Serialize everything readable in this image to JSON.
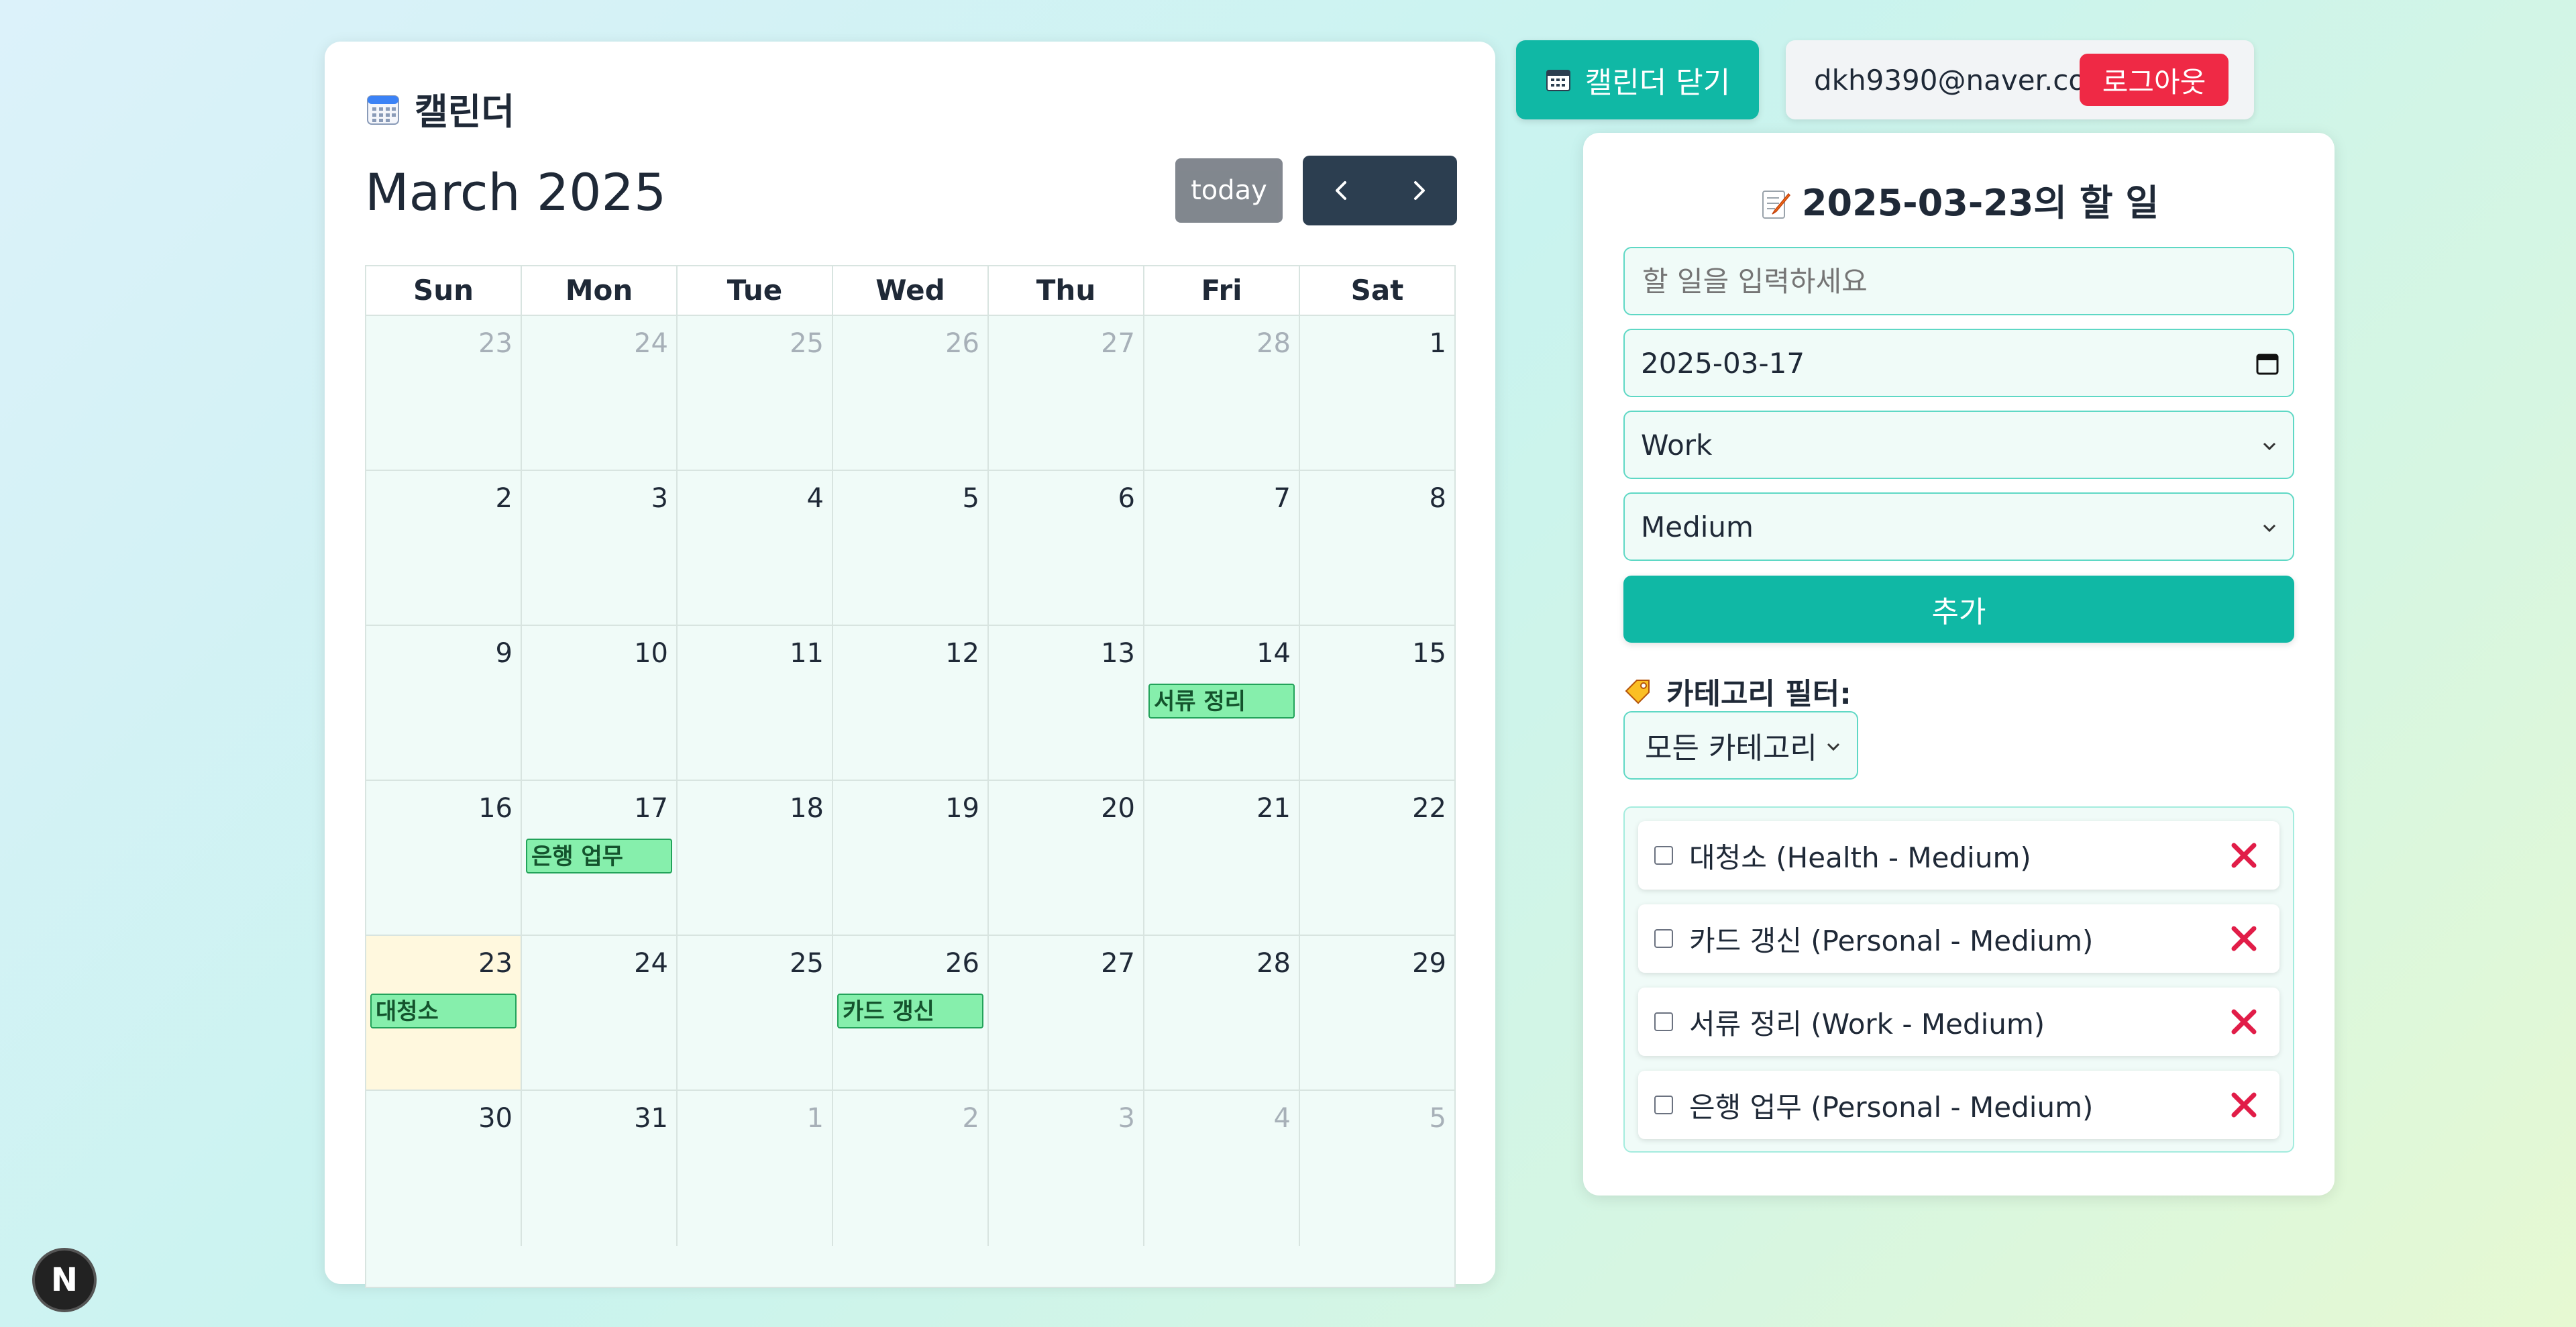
{
  "calendar": {
    "header_title": "캘린더",
    "month_title": "March 2025",
    "today_label": "today",
    "weekdays": [
      "Sun",
      "Mon",
      "Tue",
      "Wed",
      "Thu",
      "Fri",
      "Sat"
    ],
    "weeks": [
      [
        {
          "n": "23",
          "other": true
        },
        {
          "n": "24",
          "other": true
        },
        {
          "n": "25",
          "other": true
        },
        {
          "n": "26",
          "other": true
        },
        {
          "n": "27",
          "other": true
        },
        {
          "n": "28",
          "other": true
        },
        {
          "n": "1"
        }
      ],
      [
        {
          "n": "2"
        },
        {
          "n": "3"
        },
        {
          "n": "4"
        },
        {
          "n": "5"
        },
        {
          "n": "6"
        },
        {
          "n": "7"
        },
        {
          "n": "8"
        }
      ],
      [
        {
          "n": "9"
        },
        {
          "n": "10"
        },
        {
          "n": "11"
        },
        {
          "n": "12"
        },
        {
          "n": "13"
        },
        {
          "n": "14",
          "event": "서류 정리"
        },
        {
          "n": "15"
        }
      ],
      [
        {
          "n": "16"
        },
        {
          "n": "17",
          "event": "은행 업무"
        },
        {
          "n": "18"
        },
        {
          "n": "19"
        },
        {
          "n": "20"
        },
        {
          "n": "21"
        },
        {
          "n": "22"
        }
      ],
      [
        {
          "n": "23",
          "today": true,
          "event": "대청소"
        },
        {
          "n": "24"
        },
        {
          "n": "25"
        },
        {
          "n": "26",
          "event": "카드 갱신"
        },
        {
          "n": "27"
        },
        {
          "n": "28"
        },
        {
          "n": "29"
        }
      ],
      [
        {
          "n": "30"
        },
        {
          "n": "31"
        },
        {
          "n": "1",
          "other": true
        },
        {
          "n": "2",
          "other": true
        },
        {
          "n": "3",
          "other": true
        },
        {
          "n": "4",
          "other": true
        },
        {
          "n": "5",
          "other": true
        }
      ]
    ]
  },
  "topbar": {
    "close_calendar_label": "캘린더 닫기",
    "user_email": "dkh9390@naver.com",
    "logout_label": "로그아웃"
  },
  "todo": {
    "title": "2025-03-23의 할 일",
    "input_placeholder": "할 일을 입력하세요",
    "date_value": "2025-03-17",
    "category_value": "Work",
    "priority_value": "Medium",
    "add_label": "추가",
    "filter_label": "카테고리 필터:",
    "filter_value": "모든 카테고리",
    "items": [
      {
        "text": "대청소 (Health - Medium)"
      },
      {
        "text": "카드 갱신 (Personal - Medium)"
      },
      {
        "text": "서류 정리 (Work - Medium)"
      },
      {
        "text": "은행 업무 (Personal - Medium)"
      }
    ]
  },
  "badge": {
    "label": "N"
  },
  "colors": {
    "accent": "#10b8a5",
    "danger": "#ef2945",
    "event_bg": "#86efac",
    "today_bg": "#fff8de"
  }
}
